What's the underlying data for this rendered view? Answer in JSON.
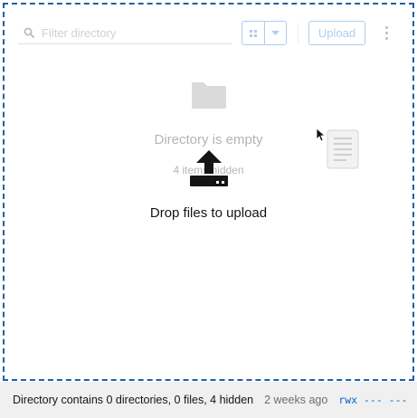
{
  "toolbar": {
    "filter_placeholder": "Filter directory",
    "upload_label": "Upload"
  },
  "empty_state": {
    "title": "Directory is empty",
    "hidden_note": "4 items hidden"
  },
  "drop_overlay": {
    "label": "Drop files to upload"
  },
  "status_bar": {
    "summary": "Directory contains 0 directories, 0 files, 4 hidden",
    "modified": "2 weeks ago",
    "permissions": "rwx --- ---"
  },
  "icons": {
    "search": "search-icon",
    "grid_view": "grid-view-icon",
    "dropdown": "caret-down-icon",
    "menu": "kebab-menu-icon",
    "folder": "folder-icon",
    "upload": "upload-icon",
    "dragged_file": "file-icon",
    "cursor": "mouse-cursor-icon"
  },
  "colors": {
    "accent": "#0066cc",
    "drop_border": "#1f5fa8",
    "footer_bg": "#f0f0f0"
  }
}
